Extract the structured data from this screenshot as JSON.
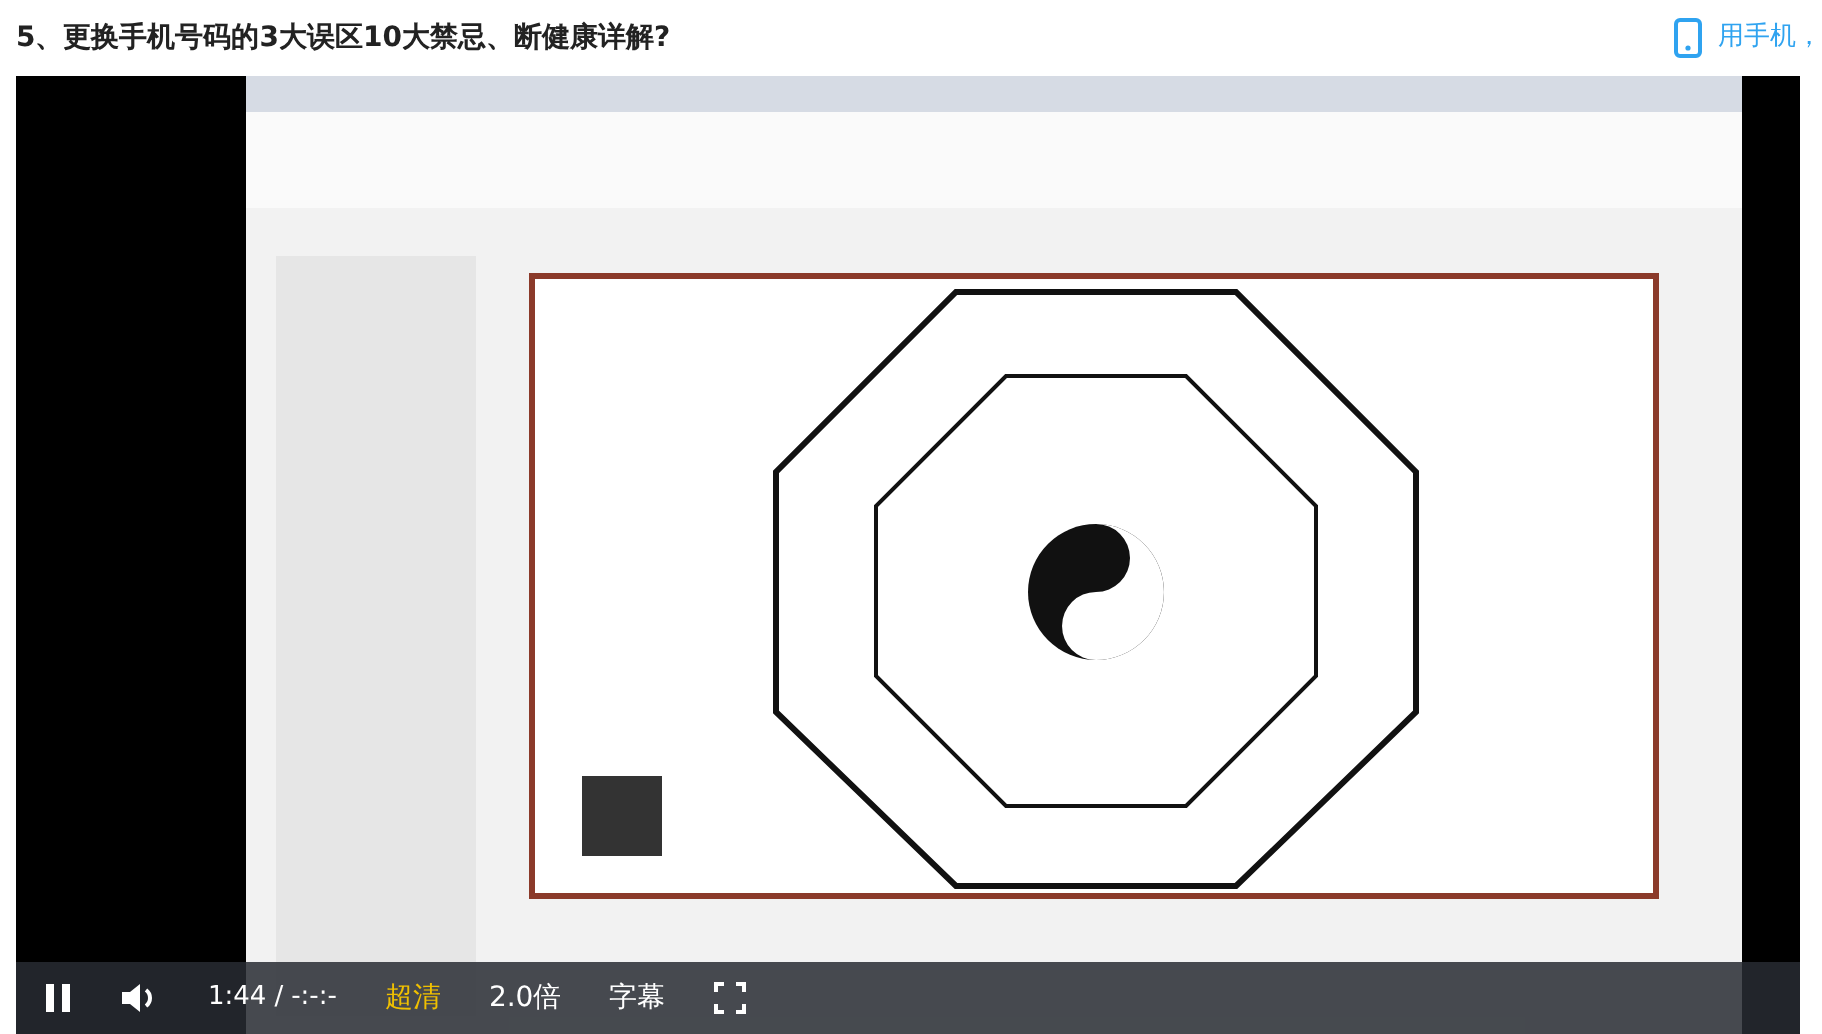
{
  "header": {
    "title": "5、更换手机号码的3大误区10大禁忌、断健康详解?",
    "mobile_link": "用手机，"
  },
  "player": {
    "playing": true,
    "muted": false,
    "current_time": "1:44",
    "separator": "/",
    "duration": "-:-:-",
    "options": [
      {
        "label": "超清",
        "highlighted": true
      },
      {
        "label": "2.0倍",
        "highlighted": false
      },
      {
        "label": "字幕",
        "highlighted": false
      }
    ]
  }
}
